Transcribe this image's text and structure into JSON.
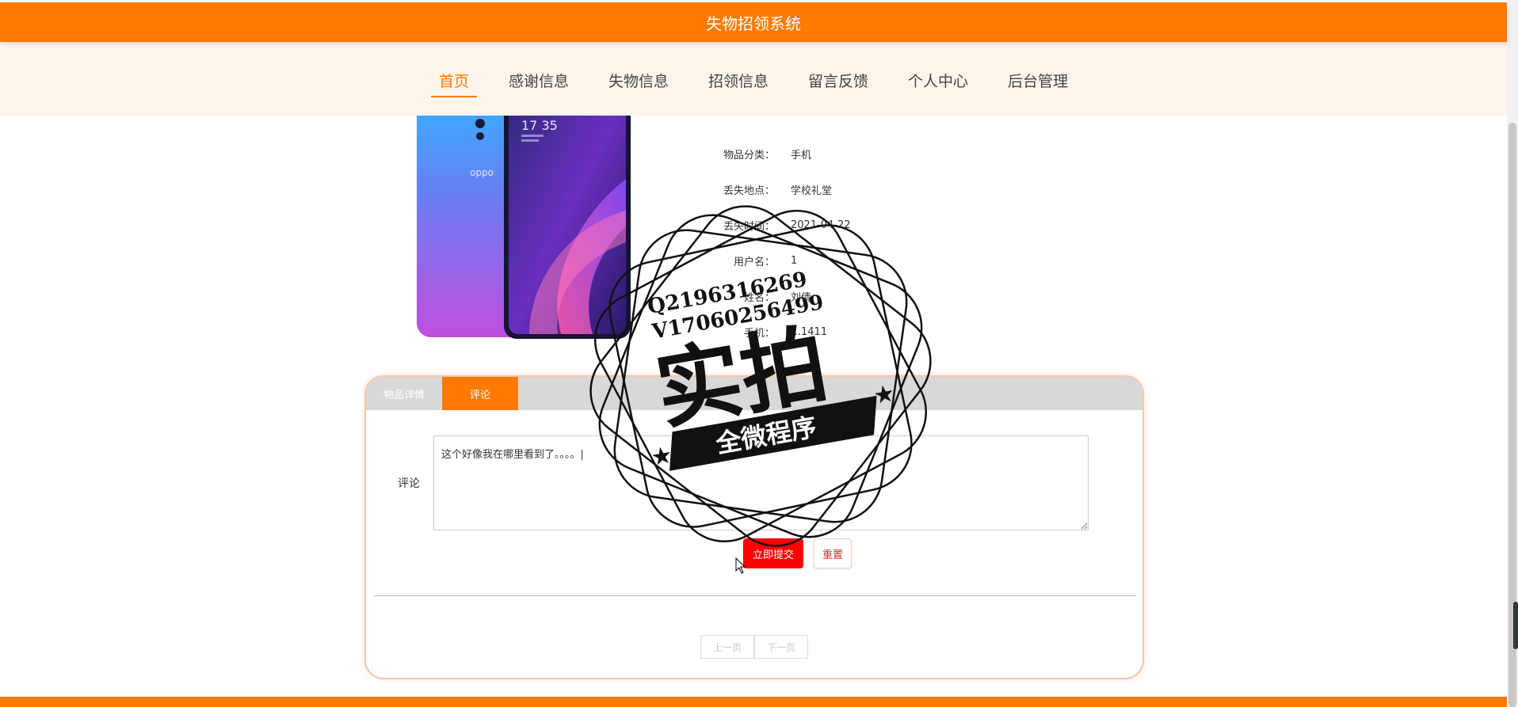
{
  "app": {
    "title": "失物招领系统"
  },
  "nav": {
    "items": [
      {
        "label": "首页",
        "active": true
      },
      {
        "label": "感谢信息"
      },
      {
        "label": "失物信息"
      },
      {
        "label": "招领信息"
      },
      {
        "label": "留言反馈"
      },
      {
        "label": "个人中心"
      },
      {
        "label": "后台管理"
      }
    ]
  },
  "product": {
    "image_alt": "oppo",
    "phone_time": "17 35",
    "info": [
      {
        "label": "物品分类：",
        "value": "手机"
      },
      {
        "label": "丢失地点：",
        "value": "学校礼堂"
      },
      {
        "label": "丢失时间：",
        "value": "2021-04-22"
      },
      {
        "label": "用户名：",
        "value": "1"
      },
      {
        "label": "姓名：",
        "value": "刘倩"
      },
      {
        "label": "手机：",
        "value": "…1411"
      }
    ]
  },
  "tabs": [
    {
      "label": "物品详情",
      "active": false
    },
    {
      "label": "评论",
      "active": true
    }
  ],
  "comment_form": {
    "label": "评论",
    "value": "这个好像我在哪里看到了。。。。|",
    "submit_label": "立即提交",
    "reset_label": "重置"
  },
  "pager": {
    "prev_label": "上一页",
    "next_label": "下一页"
  },
  "watermark": {
    "line1": "Q2196316269",
    "line2": "V17060256499",
    "big_text": "实拍",
    "ribbon_text": "全微程序"
  },
  "colors": {
    "accent": "#ff7a00",
    "nav_bg": "#fdf4ec",
    "submit": "#ff0000"
  }
}
